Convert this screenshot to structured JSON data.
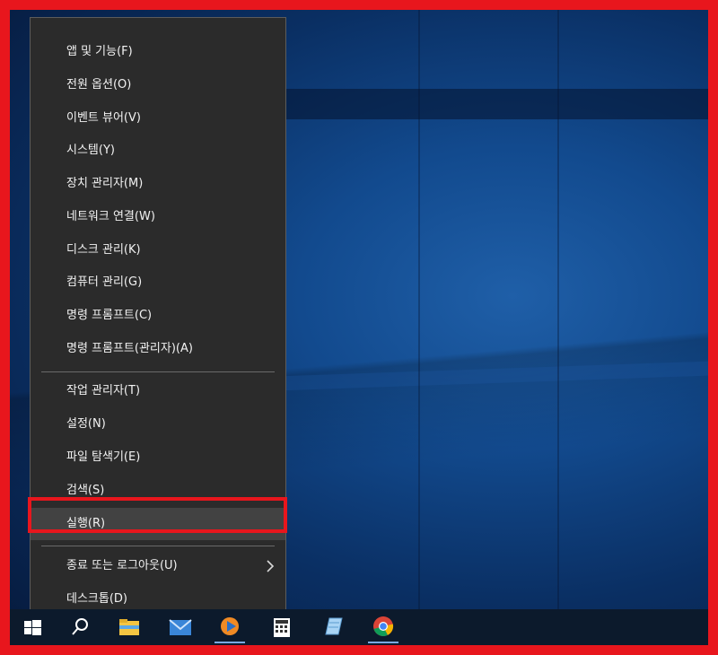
{
  "menu": {
    "items": [
      {
        "label": "앱 및 기능(F)"
      },
      {
        "label": "전원 옵션(O)"
      },
      {
        "label": "이벤트 뷰어(V)"
      },
      {
        "label": "시스템(Y)"
      },
      {
        "label": "장치 관리자(M)"
      },
      {
        "label": "네트워크 연결(W)"
      },
      {
        "label": "디스크 관리(K)"
      },
      {
        "label": "컴퓨터 관리(G)"
      },
      {
        "label": "명령 프롬프트(C)"
      },
      {
        "label": "명령 프롬프트(관리자)(A)"
      },
      {
        "label": "작업 관리자(T)"
      },
      {
        "label": "설정(N)"
      },
      {
        "label": "파일 탐색기(E)"
      },
      {
        "label": "검색(S)"
      },
      {
        "label": "실행(R)"
      },
      {
        "label": "종료 또는 로그아웃(U)"
      },
      {
        "label": "데스크톱(D)"
      }
    ]
  },
  "colors": {
    "menu_bg": "#2b2b2b",
    "menu_text": "#f2f2f2",
    "highlight_border": "#e8161d",
    "frame_border": "#e8161d",
    "taskbar_bg": "#0c1a2c"
  },
  "taskbar": {
    "icons": [
      {
        "icon": "windows-start-icon"
      },
      {
        "icon": "search-icon"
      },
      {
        "icon": "file-explorer-icon"
      },
      {
        "icon": "mail-icon"
      },
      {
        "icon": "media-player-icon"
      },
      {
        "icon": "calculator-icon"
      },
      {
        "icon": "notepad-icon"
      },
      {
        "icon": "chrome-icon"
      }
    ]
  }
}
